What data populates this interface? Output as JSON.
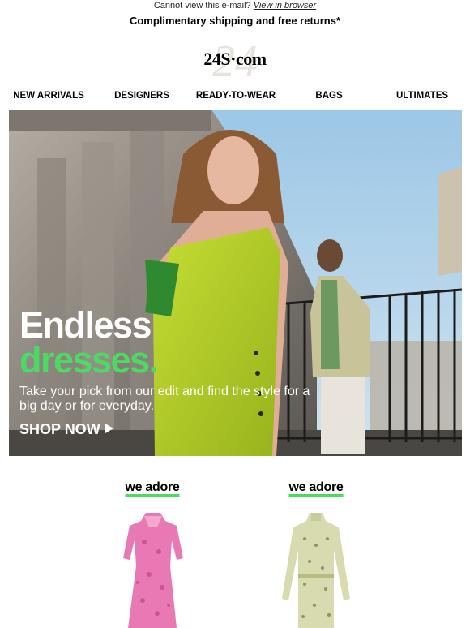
{
  "preheader": {
    "text": "Cannot view this e-mail?",
    "link": "View in browser"
  },
  "shipping": "Complimentary shipping and free returns*",
  "logo": "24S·com",
  "nav": [
    "NEW ARRIVALS",
    "DESIGNERS",
    "READY-TO-WEAR",
    "BAGS",
    "ULTIMATES"
  ],
  "hero": {
    "title_line1": "Endless",
    "title_line2": "dresses.",
    "subtitle": "Take your pick from our edit and find the style for a big day or for everyday.",
    "cta": "SHOP NOW"
  },
  "products": [
    {
      "tag": "we adore",
      "item": "pink floral dress"
    },
    {
      "tag": "we adore",
      "item": "green print dress"
    }
  ],
  "colors": {
    "accent": "#4cd964",
    "hero_dress": "#b9d42a",
    "text": "#000000"
  }
}
